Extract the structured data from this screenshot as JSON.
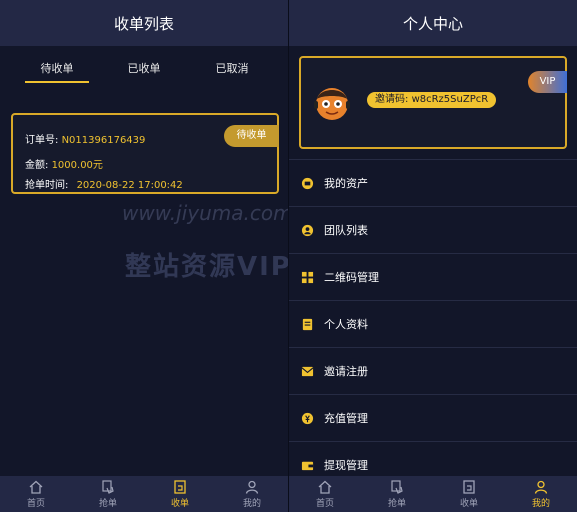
{
  "left": {
    "title": "收单列表",
    "tabs": [
      "待收单",
      "已收单",
      "已取消"
    ],
    "order": {
      "order_no_label": "订单号:",
      "order_no": "N011396176439",
      "amount_label": "金额:",
      "amount": "1000.00元",
      "time_label": "抢单时间:",
      "time": "2020-08-22 17:00:42",
      "status": "待收单"
    },
    "watermark": {
      "line1": "www.jiyuma.com",
      "line2": "整站资源VIP免费下载"
    }
  },
  "right": {
    "title": "个人中心",
    "invite_label": "邀请码:",
    "invite_code": "w8cRz5SuZPcR",
    "vip": "VIP",
    "menu": [
      {
        "label": "我的资产",
        "icon": "assets-icon"
      },
      {
        "label": "团队列表",
        "icon": "team-icon"
      },
      {
        "label": "二维码管理",
        "icon": "qrcode-icon"
      },
      {
        "label": "个人资料",
        "icon": "profile-icon"
      },
      {
        "label": "邀请注册",
        "icon": "invite-icon"
      },
      {
        "label": "充值管理",
        "icon": "recharge-icon"
      },
      {
        "label": "提现管理",
        "icon": "withdraw-icon"
      }
    ]
  },
  "nav": [
    {
      "label": "首页",
      "icon": "home-icon"
    },
    {
      "label": "抢单",
      "icon": "grab-order-icon"
    },
    {
      "label": "收单",
      "icon": "receive-order-icon"
    },
    {
      "label": "我的",
      "icon": "user-icon"
    }
  ],
  "colors": {
    "accent": "#f0c230",
    "background": "#121629",
    "header": "#232845"
  }
}
